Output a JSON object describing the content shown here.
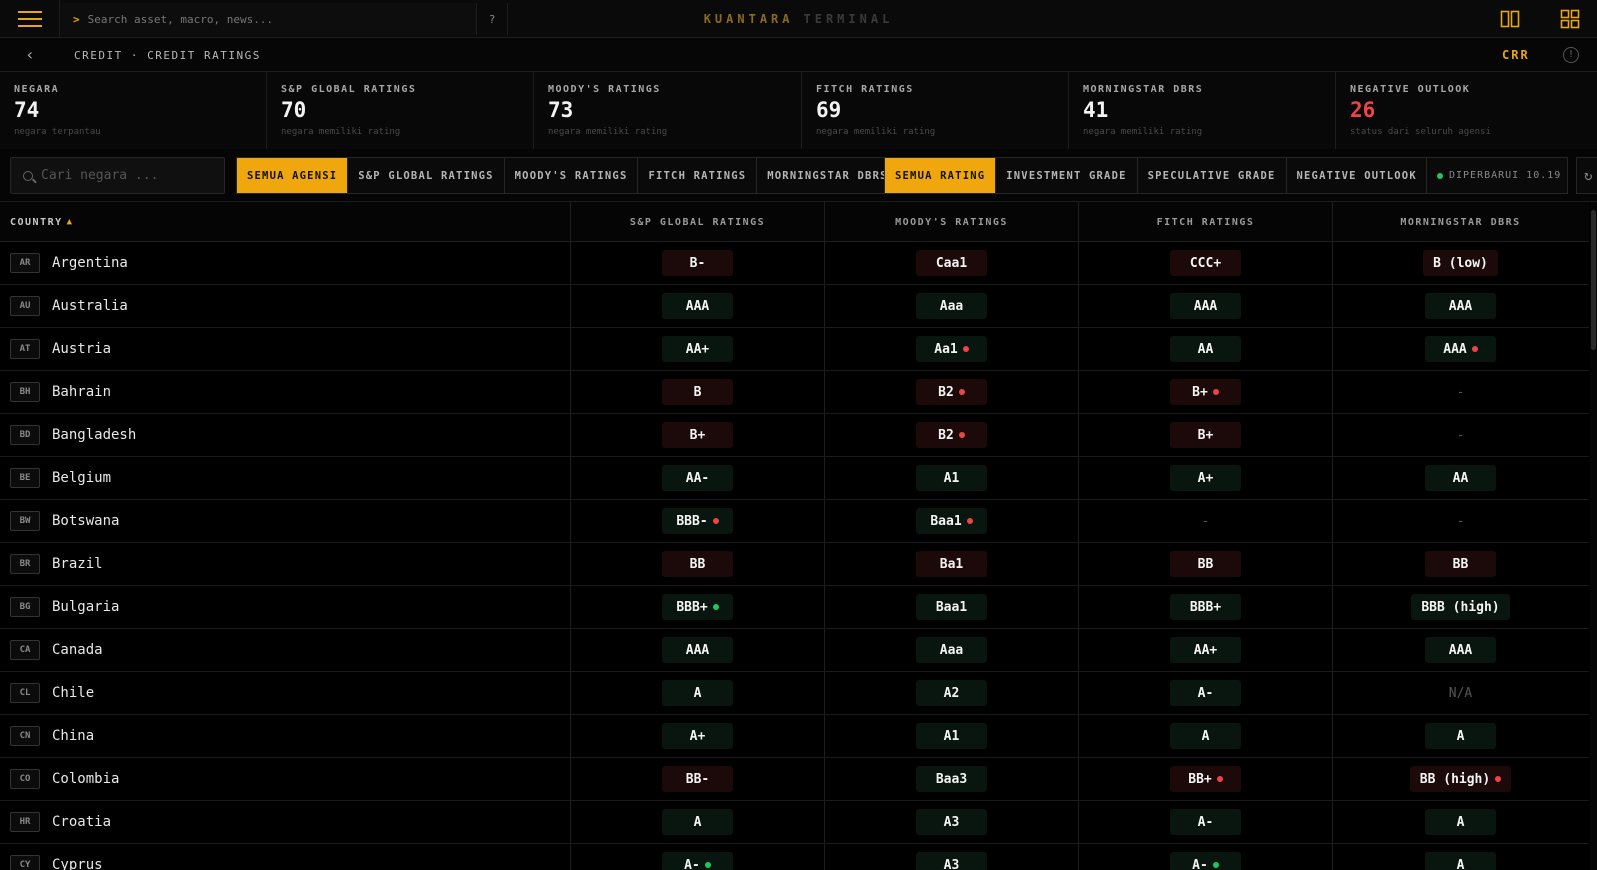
{
  "app": {
    "brand_primary": "KUANTARA",
    "brand_secondary": "TERMINAL",
    "search_placeholder": "Search asset, macro, news...",
    "help_label": "?"
  },
  "breadcrumb": {
    "text": "CREDIT · CREDIT RATINGS",
    "code": "CRR"
  },
  "stats": [
    {
      "label": "NEGARA",
      "value": "74",
      "sub": "negara terpantau",
      "highlight": false
    },
    {
      "label": "S&P GLOBAL RATINGS",
      "value": "70",
      "sub": "negara memiliki rating",
      "highlight": false
    },
    {
      "label": "MOODY'S RATINGS",
      "value": "73",
      "sub": "negara memiliki rating",
      "highlight": false
    },
    {
      "label": "FITCH RATINGS",
      "value": "69",
      "sub": "negara memiliki rating",
      "highlight": false
    },
    {
      "label": "MORNINGSTAR DBRS",
      "value": "41",
      "sub": "negara memiliki rating",
      "highlight": false
    },
    {
      "label": "NEGATIVE OUTLOOK",
      "value": "26",
      "sub": "status dari seluruh agensi",
      "highlight": true
    }
  ],
  "filters": {
    "country_search_placeholder": "Cari negara ...",
    "agency_buttons": [
      "SEMUA AGENSI",
      "S&P GLOBAL RATINGS",
      "MOODY'S RATINGS",
      "FITCH RATINGS",
      "MORNINGSTAR DBRS"
    ],
    "agency_active": 0,
    "rating_buttons": [
      "SEMUA RATING",
      "INVESTMENT GRADE",
      "SPECULATIVE GRADE",
      "NEGATIVE OUTLOOK"
    ],
    "rating_active": 0,
    "updated_label": "DIPERBARUI 10.19"
  },
  "table": {
    "country_header": "COUNTRY",
    "sort_indicator": "▲",
    "agency_headers": [
      "S&P GLOBAL RATINGS",
      "MOODY'S RATINGS",
      "FITCH RATINGS",
      "MORNINGSTAR DBRS"
    ],
    "rows": [
      {
        "code": "AR",
        "name": "Argentina",
        "ratings": [
          {
            "r": "B-",
            "g": "sg",
            "o": ""
          },
          {
            "r": "Caa1",
            "g": "sg",
            "o": ""
          },
          {
            "r": "CCC+",
            "g": "sg",
            "o": ""
          },
          {
            "r": "B (low)",
            "g": "sg",
            "o": ""
          }
        ]
      },
      {
        "code": "AU",
        "name": "Australia",
        "ratings": [
          {
            "r": "AAA",
            "g": "ig",
            "o": ""
          },
          {
            "r": "Aaa",
            "g": "ig",
            "o": ""
          },
          {
            "r": "AAA",
            "g": "ig",
            "o": ""
          },
          {
            "r": "AAA",
            "g": "ig",
            "o": ""
          }
        ]
      },
      {
        "code": "AT",
        "name": "Austria",
        "ratings": [
          {
            "r": "AA+",
            "g": "ig",
            "o": ""
          },
          {
            "r": "Aa1",
            "g": "ig",
            "o": "neg"
          },
          {
            "r": "AA",
            "g": "ig",
            "o": ""
          },
          {
            "r": "AAA",
            "g": "ig",
            "o": "neg"
          }
        ]
      },
      {
        "code": "BH",
        "name": "Bahrain",
        "ratings": [
          {
            "r": "B",
            "g": "sg",
            "o": ""
          },
          {
            "r": "B2",
            "g": "sg",
            "o": "neg"
          },
          {
            "r": "B+",
            "g": "sg",
            "o": "neg"
          },
          {
            "r": "-",
            "g": "none",
            "o": ""
          }
        ]
      },
      {
        "code": "BD",
        "name": "Bangladesh",
        "ratings": [
          {
            "r": "B+",
            "g": "sg",
            "o": ""
          },
          {
            "r": "B2",
            "g": "sg",
            "o": "neg"
          },
          {
            "r": "B+",
            "g": "sg",
            "o": ""
          },
          {
            "r": "-",
            "g": "none",
            "o": ""
          }
        ]
      },
      {
        "code": "BE",
        "name": "Belgium",
        "ratings": [
          {
            "r": "AA-",
            "g": "ig",
            "o": ""
          },
          {
            "r": "A1",
            "g": "ig",
            "o": ""
          },
          {
            "r": "A+",
            "g": "ig",
            "o": ""
          },
          {
            "r": "AA",
            "g": "ig",
            "o": ""
          }
        ]
      },
      {
        "code": "BW",
        "name": "Botswana",
        "ratings": [
          {
            "r": "BBB-",
            "g": "ig",
            "o": "neg"
          },
          {
            "r": "Baa1",
            "g": "ig",
            "o": "neg"
          },
          {
            "r": "-",
            "g": "none",
            "o": ""
          },
          {
            "r": "-",
            "g": "none",
            "o": ""
          }
        ]
      },
      {
        "code": "BR",
        "name": "Brazil",
        "ratings": [
          {
            "r": "BB",
            "g": "sg",
            "o": ""
          },
          {
            "r": "Ba1",
            "g": "sg",
            "o": ""
          },
          {
            "r": "BB",
            "g": "sg",
            "o": ""
          },
          {
            "r": "BB",
            "g": "sg",
            "o": ""
          }
        ]
      },
      {
        "code": "BG",
        "name": "Bulgaria",
        "ratings": [
          {
            "r": "BBB+",
            "g": "ig",
            "o": "pos"
          },
          {
            "r": "Baa1",
            "g": "ig",
            "o": ""
          },
          {
            "r": "BBB+",
            "g": "ig",
            "o": ""
          },
          {
            "r": "BBB (high)",
            "g": "ig",
            "o": ""
          }
        ]
      },
      {
        "code": "CA",
        "name": "Canada",
        "ratings": [
          {
            "r": "AAA",
            "g": "ig",
            "o": ""
          },
          {
            "r": "Aaa",
            "g": "ig",
            "o": ""
          },
          {
            "r": "AA+",
            "g": "ig",
            "o": ""
          },
          {
            "r": "AAA",
            "g": "ig",
            "o": ""
          }
        ]
      },
      {
        "code": "CL",
        "name": "Chile",
        "ratings": [
          {
            "r": "A",
            "g": "ig",
            "o": ""
          },
          {
            "r": "A2",
            "g": "ig",
            "o": ""
          },
          {
            "r": "A-",
            "g": "ig",
            "o": ""
          },
          {
            "r": "N/A",
            "g": "na",
            "o": ""
          }
        ]
      },
      {
        "code": "CN",
        "name": "China",
        "ratings": [
          {
            "r": "A+",
            "g": "ig",
            "o": ""
          },
          {
            "r": "A1",
            "g": "ig",
            "o": ""
          },
          {
            "r": "A",
            "g": "ig",
            "o": ""
          },
          {
            "r": "A",
            "g": "ig",
            "o": ""
          }
        ]
      },
      {
        "code": "CO",
        "name": "Colombia",
        "ratings": [
          {
            "r": "BB-",
            "g": "sg",
            "o": ""
          },
          {
            "r": "Baa3",
            "g": "ig",
            "o": ""
          },
          {
            "r": "BB+",
            "g": "sg",
            "o": "neg"
          },
          {
            "r": "BB (high)",
            "g": "sg",
            "o": "neg"
          }
        ]
      },
      {
        "code": "HR",
        "name": "Croatia",
        "ratings": [
          {
            "r": "A",
            "g": "ig",
            "o": ""
          },
          {
            "r": "A3",
            "g": "ig",
            "o": ""
          },
          {
            "r": "A-",
            "g": "ig",
            "o": ""
          },
          {
            "r": "A",
            "g": "ig",
            "o": ""
          }
        ]
      },
      {
        "code": "CY",
        "name": "Cyprus",
        "ratings": [
          {
            "r": "A-",
            "g": "ig",
            "o": "pos"
          },
          {
            "r": "A3",
            "g": "ig",
            "o": ""
          },
          {
            "r": "A-",
            "g": "ig",
            "o": "pos"
          },
          {
            "r": "A",
            "g": "ig",
            "o": ""
          }
        ]
      }
    ]
  },
  "colors": {
    "accent": "#f0a70e",
    "negative": "#ef4444",
    "positive": "#22c55e",
    "investment_grade_bg": "#08160f",
    "speculative_grade_bg": "#1c0a0b"
  }
}
